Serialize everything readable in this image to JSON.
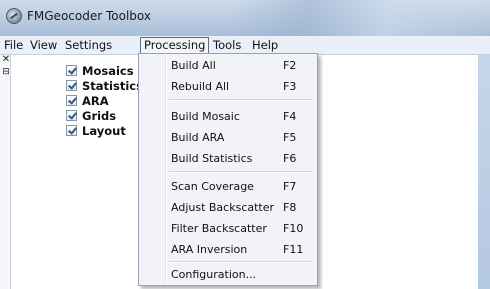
{
  "window": {
    "title": "FMGeocoder Toolbox",
    "icon": "app-globe-icon"
  },
  "menubar": {
    "items": [
      {
        "label": "File"
      },
      {
        "label": "View"
      },
      {
        "label": "Settings"
      },
      {
        "label": "Processing",
        "active": true
      },
      {
        "label": "Tools"
      },
      {
        "label": "Help"
      }
    ]
  },
  "dock": {
    "close_glyph": "✕",
    "pin_glyph": "⊟"
  },
  "layers": [
    {
      "label": "Mosaics",
      "checked": true
    },
    {
      "label": "Statistics",
      "checked": true
    },
    {
      "label": "ARA",
      "checked": true
    },
    {
      "label": "Grids",
      "checked": true
    },
    {
      "label": "Layout",
      "checked": true
    }
  ],
  "processing_menu": {
    "items": [
      {
        "label": "Build All",
        "shortcut": "F2"
      },
      {
        "label": "Rebuild All",
        "shortcut": "F3"
      },
      {
        "label": "Build Mosaic",
        "shortcut": "F4"
      },
      {
        "label": "Build ARA",
        "shortcut": "F5"
      },
      {
        "label": "Build Statistics",
        "shortcut": "F6"
      },
      {
        "label": "Scan Coverage",
        "shortcut": "F7"
      },
      {
        "label": "Adjust Backscatter",
        "shortcut": "F8"
      },
      {
        "label": "Filter Backscatter",
        "shortcut": "F10"
      },
      {
        "label": "ARA Inversion",
        "shortcut": "F11"
      },
      {
        "label": "Configuration...",
        "shortcut": ""
      }
    ]
  },
  "colors": {
    "titlebar": "#bccde2",
    "menubar": "#eaf0f8",
    "dropdown_bg": "#f1f3f6",
    "checkmark": "#2d5a8a"
  }
}
